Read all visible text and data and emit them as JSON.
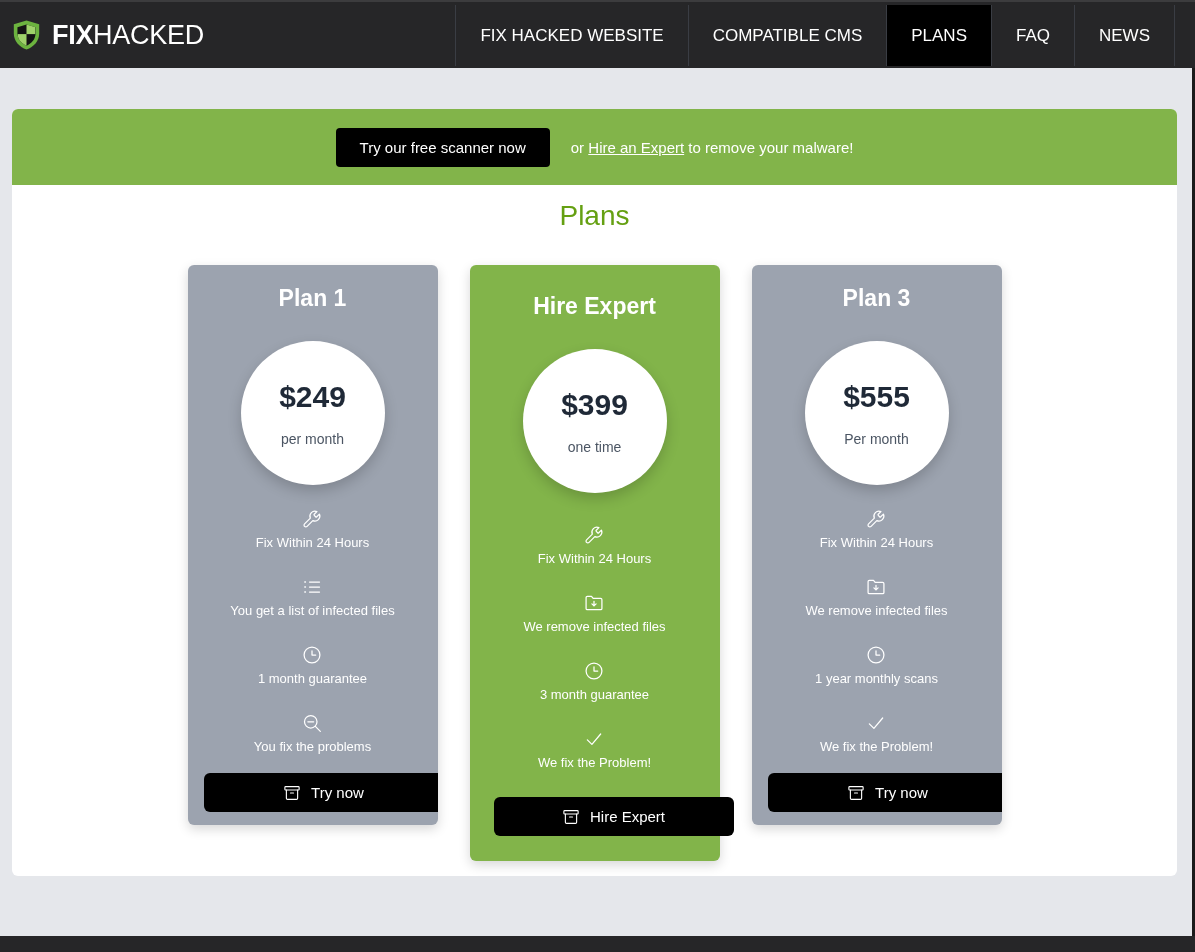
{
  "header": {
    "logo": "**FIX**HACKED",
    "nav": [
      {
        "label": "FIX HACKED WEBSITE",
        "selected": false
      },
      {
        "label": "COMPATIBLE CMS",
        "selected": false
      },
      {
        "label": "PLANS",
        "selected": true
      },
      {
        "label": "FAQ",
        "selected": false
      },
      {
        "label": "NEWS",
        "selected": false
      }
    ]
  },
  "banner": {
    "button": "Try our free scanner now",
    "message_start": "or",
    "link": "Hire an Expert",
    "message_end": "to remove your malware!"
  },
  "plans": {
    "title": "Plans",
    "cards": [
      {
        "name": "Plan 1",
        "featured": false,
        "price": "$249",
        "period": "per month",
        "features": [
          {
            "kind": "repair",
            "text": "Fix Within 24 Hours"
          },
          {
            "kind": "report",
            "text": "You get a list of infected files"
          },
          {
            "kind": "time",
            "text": "1 month guarantee"
          },
          {
            "kind": "diy",
            "text": "You fix the problems"
          }
        ],
        "button": "Try now"
      },
      {
        "name": "Hire Expert",
        "featured": true,
        "price": "$399",
        "period": "one time",
        "features": [
          {
            "kind": "repair",
            "text": "Fix Within 24 Hours"
          },
          {
            "kind": "removal",
            "text": "We remove infected files"
          },
          {
            "kind": "time",
            "text": "3 month guarantee"
          },
          {
            "kind": "done",
            "text": "We fix the Problem!"
          }
        ],
        "button": "Hire Expert"
      },
      {
        "name": "Plan 3",
        "featured": false,
        "price": "$555",
        "period": "Per month",
        "features": [
          {
            "kind": "repair",
            "text": "Fix Within 24 Hours"
          },
          {
            "kind": "removal",
            "text": "We remove infected files"
          },
          {
            "kind": "time",
            "text": "1 year monthly scans"
          },
          {
            "kind": "done",
            "text": "We fix the Problem!"
          }
        ],
        "button": "Try now"
      }
    ]
  }
}
